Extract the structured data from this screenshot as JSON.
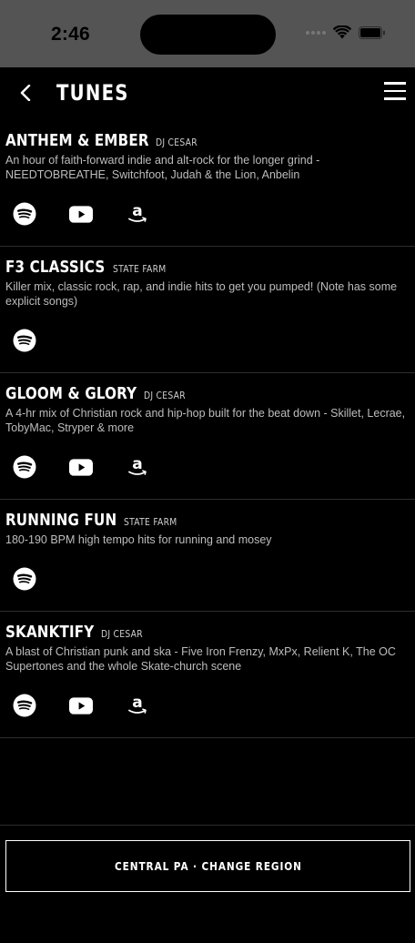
{
  "status_bar": {
    "time": "2:46"
  },
  "header": {
    "title": "TUNES"
  },
  "playlists": [
    {
      "name": "ANTHEM & EMBER",
      "curator": "DJ CESAR",
      "description": "An hour of faith-forward indie and alt-rock for the longer grind - NEEDTOBREATHE, Switchfoot, Judah & the Lion, Anbelin",
      "links": [
        "spotify-icon",
        "youtube-icon",
        "amazon-music-icon"
      ]
    },
    {
      "name": "F3 CLASSICS",
      "curator": "STATE FARM",
      "description": "Killer mix, classic rock, rap, and indie hits to get you pumped! (Note has some explicit songs)",
      "links": [
        "spotify-icon"
      ]
    },
    {
      "name": "GLOOM & GLORY",
      "curator": "DJ CESAR",
      "description": "A 4-hr mix of Christian rock and hip-hop built for the beat down - Skillet, Lecrae, TobyMac, Stryper & more",
      "links": [
        "spotify-icon",
        "youtube-icon",
        "amazon-music-icon"
      ]
    },
    {
      "name": "RUNNING FUN",
      "curator": "STATE FARM",
      "description": "180-190 BPM high tempo hits for running and mosey",
      "links": [
        "spotify-icon"
      ]
    },
    {
      "name": "SKANKTIFY",
      "curator": "DJ CESAR",
      "description": "A blast of Christian punk and ska - Five Iron Frenzy, MxPx, Relient K, The OC Supertones and the whole Skate-church scene",
      "links": [
        "spotify-icon",
        "youtube-icon",
        "amazon-music-icon"
      ]
    }
  ],
  "footer": {
    "region_button_label": "CENTRAL PA · CHANGE REGION"
  }
}
